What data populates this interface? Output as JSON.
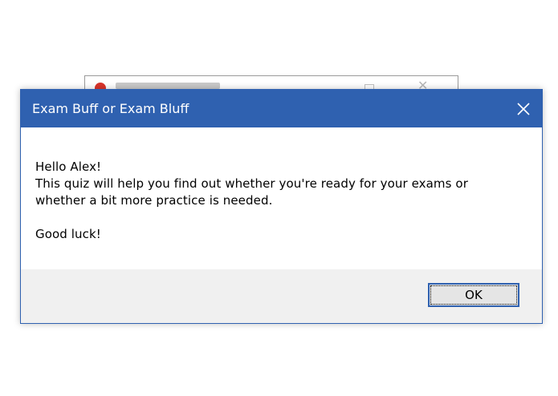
{
  "dialog": {
    "title": "Exam Buff or Exam Bluff",
    "close_icon": "close-icon",
    "message": {
      "greeting": "Hello Alex!",
      "line1": "This quiz will help you find out whether you're ready for your exams or",
      "line2": "whether a bit more practice is needed.",
      "closing": "Good luck!"
    },
    "ok_label": "OK"
  },
  "colors": {
    "titlebar": "#2f61b0",
    "footer": "#f0f0f0",
    "content": "#ffffff"
  }
}
